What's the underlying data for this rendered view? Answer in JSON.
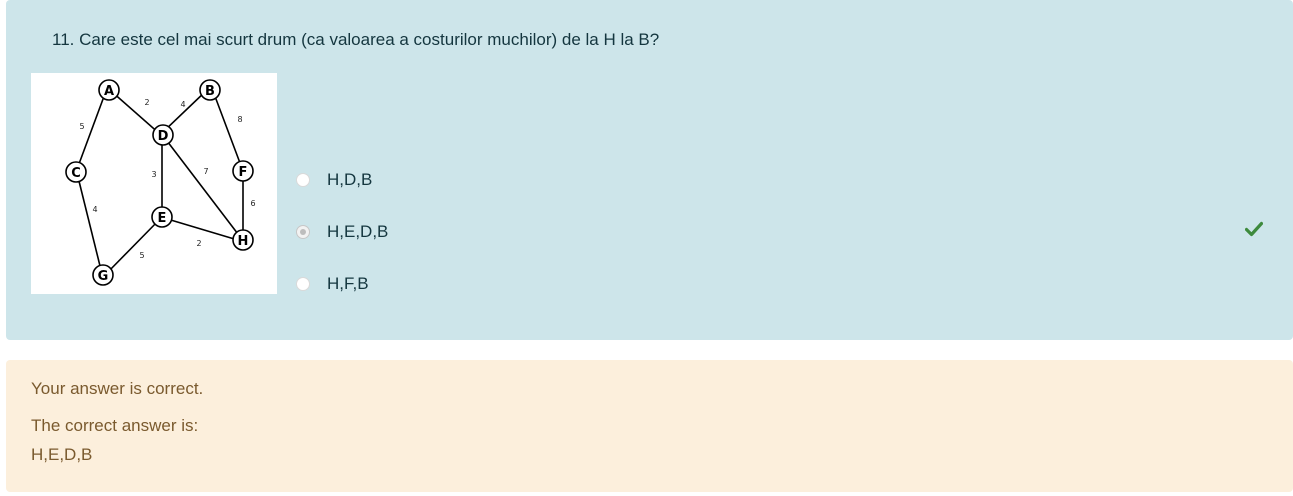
{
  "question": {
    "text": "11. Care este cel mai scurt drum (ca valoarea a costurilor muchilor) de la H la B?",
    "graph": {
      "nodes": [
        "A",
        "B",
        "C",
        "D",
        "E",
        "F",
        "G",
        "H"
      ],
      "edge_weights": {
        "A-C": "5",
        "A-D": "2",
        "B-D": "4",
        "B-F": "8",
        "D-E": "3",
        "D-H": "7",
        "F-H": "6",
        "C-G": "4",
        "E-G": "5",
        "E-H": "2"
      }
    },
    "options": [
      {
        "label": "H,D,B",
        "selected": false
      },
      {
        "label": "H,E,D,B",
        "selected": true
      },
      {
        "label": "H,F,B",
        "selected": false
      }
    ],
    "status_icon": "checkmark-icon",
    "status_color": "#3d8a3d"
  },
  "feedback": {
    "result": "Your answer is correct.",
    "correct_label": "The correct answer is:",
    "correct_answer": "H,E,D,B"
  }
}
